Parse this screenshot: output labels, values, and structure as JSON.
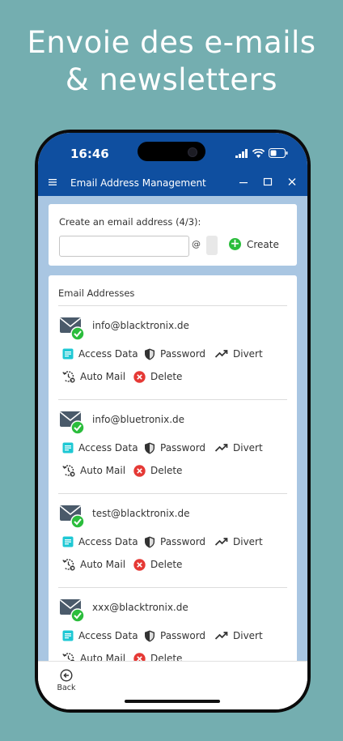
{
  "promo": {
    "line1": "Envoie des e-mails",
    "line2": "& newsletters"
  },
  "status_bar": {
    "time": "16:46"
  },
  "window": {
    "title": "Email Address Management",
    "menu_icon": "hamburger-icon",
    "controls": [
      "minimize-icon",
      "maximize-icon",
      "close-icon"
    ]
  },
  "create": {
    "label": "Create an email address (4/3):",
    "input_value": "",
    "at_sign": "@",
    "button_label": "Create"
  },
  "list": {
    "heading": "Email Addresses",
    "actions": {
      "access_data": "Access Data",
      "password": "Password",
      "divert": "Divert",
      "auto_mail": "Auto Mail",
      "delete": "Delete"
    },
    "items": [
      {
        "address": "info@blacktronix.de"
      },
      {
        "address": "info@bluetronix.de"
      },
      {
        "address": "test@blacktronix.de"
      },
      {
        "address": "xxx@blacktronix.de"
      }
    ]
  },
  "bottom_bar": {
    "back_label": "Back"
  },
  "colors": {
    "primary": "#0f4fa0",
    "content_bg": "#a9c6e2",
    "success": "#2bbd3c",
    "danger": "#e53935",
    "info": "#1ec8d4"
  }
}
